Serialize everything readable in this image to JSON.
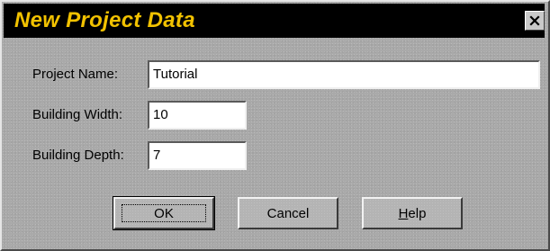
{
  "window": {
    "title": "New Project Data",
    "close_icon": "close-icon"
  },
  "form": {
    "project_name": {
      "label": "Project Name:",
      "value": "Tutorial"
    },
    "building_width": {
      "label": "Building Width:",
      "value": "10"
    },
    "building_depth": {
      "label": "Building Depth:",
      "value": "7"
    }
  },
  "buttons": {
    "ok": "OK",
    "cancel": "Cancel",
    "help_mnemonic": "H",
    "help_rest": "elp"
  },
  "colors": {
    "title_text": "#f2c200",
    "titlebar_bg": "#000000",
    "dialog_bg": "#a9a9a9"
  }
}
